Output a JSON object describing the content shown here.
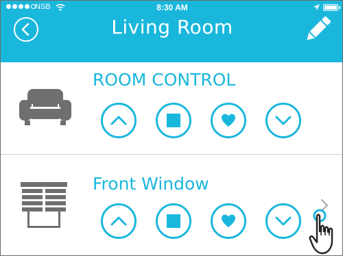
{
  "status_bar": {
    "carrier": "NSB",
    "time": "8:30 AM"
  },
  "header": {
    "title": "Living Room",
    "back_icon": "chevron-left-circle-icon",
    "edit_icon": "pencil-icon"
  },
  "sections": [
    {
      "title": "ROOM CONTROL",
      "icon": "armchair-icon",
      "controls": [
        "up",
        "stop",
        "favorite",
        "down"
      ]
    },
    {
      "title": "Front Window",
      "icon": "blinds-icon",
      "controls": [
        "up",
        "stop",
        "favorite",
        "down"
      ],
      "has_detail_chevron": true
    }
  ],
  "colors": {
    "accent": "#1ab7dc",
    "icon_gray": "#6f6f6f",
    "divider": "#cfcfcf"
  }
}
